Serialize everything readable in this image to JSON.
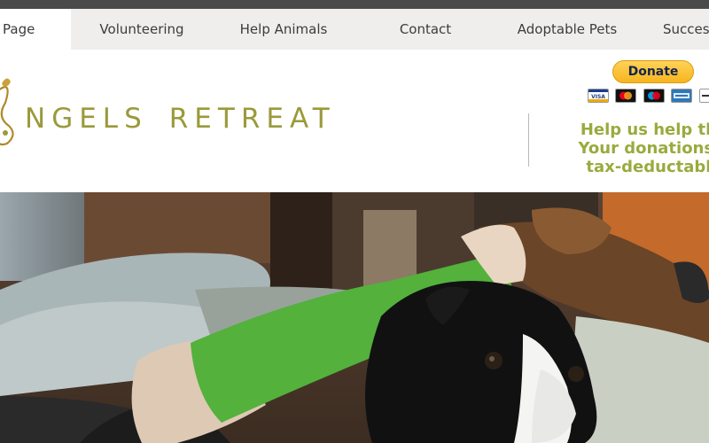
{
  "nav": {
    "items": [
      {
        "label": "Page"
      },
      {
        "label": "Volunteering"
      },
      {
        "label": "Help Animals"
      },
      {
        "label": "Contact"
      },
      {
        "label": "Adoptable Pets"
      },
      {
        "label": "Success"
      }
    ]
  },
  "header": {
    "logo_text_left": "NGELS",
    "logo_text_right": "RETREAT",
    "donate_label": "Donate",
    "card_icons": [
      "visa-card-icon",
      "mastercard-icon",
      "maestro-card-icon",
      "amex-card-icon",
      "discover-card-icon",
      "card-icon"
    ],
    "appeal_lines": [
      "Help us help the",
      "Your donations a",
      "tax-deductable"
    ]
  },
  "colors": {
    "brand_olive": "#9a9a3a",
    "appeal_green": "#9aaa3e",
    "nav_bg": "#efeeec",
    "topbar": "#4a4a4a"
  }
}
